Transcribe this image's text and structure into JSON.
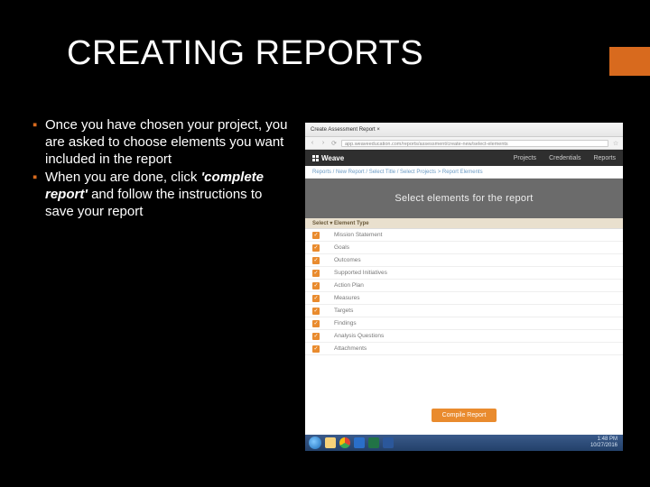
{
  "slide": {
    "title": "CREATING REPORTS",
    "bullets": [
      {
        "text": "Once you have chosen your project, you are asked to choose elements you want included in the report"
      },
      {
        "pre": "When you are done, click ",
        "bold": "'complete report'",
        "post": "  and follow the instructions to save your report"
      }
    ]
  },
  "screenshot": {
    "browser": {
      "tab1": "Create Assessment Report  ×",
      "url": "app.weaveeducation.com/reports/assessment/create-new/select-elements"
    },
    "weave": {
      "brand": "Weave",
      "nav": [
        "Projects",
        "Credentials",
        "Reports"
      ]
    },
    "breadcrumb": "Reports / New Report / Select Title / Select Projects > Report Elements",
    "hero": "Select elements for the report",
    "table": {
      "head_select": "Select ▾",
      "head_type": "Element Type",
      "rows": [
        "Mission Statement",
        "Goals",
        "Outcomes",
        "Supported Initiatives",
        "Action Plan",
        "Measures",
        "Targets",
        "Findings",
        "Analysis Questions",
        "Attachments"
      ]
    },
    "compile": "Compile Report",
    "clock": {
      "time": "1:48 PM",
      "date": "10/27/2016"
    }
  }
}
